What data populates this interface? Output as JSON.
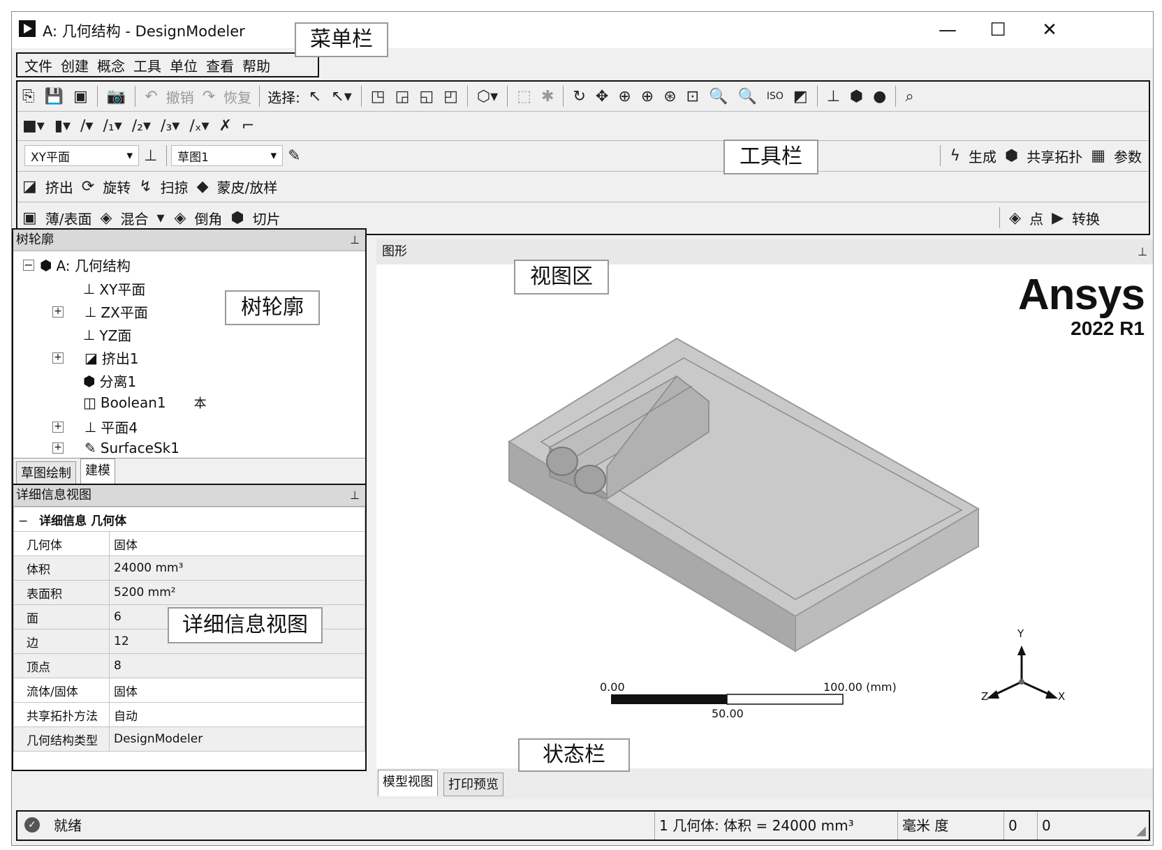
{
  "window": {
    "title": "A: 几何结构 - DesignModeler",
    "controls": {
      "minimize": "—",
      "maximize": "☐",
      "close": "✕"
    }
  },
  "menubar": {
    "items": [
      "文件",
      "创建",
      "概念",
      "工具",
      "单位",
      "查看",
      "帮助"
    ]
  },
  "toolbar": {
    "undo_label": "撤销",
    "redo_label": "恢复",
    "select_label": "选择:",
    "plane_select": "XY平面",
    "sketch_select": "草图1",
    "generate_label": "生成",
    "share_topology_label": "共享拓扑",
    "parameters_label": "参数",
    "ops_row1": [
      "挤出",
      "旋转",
      "扫掠",
      "蒙皮/放样"
    ],
    "ops_row2": [
      "薄/表面",
      "混合",
      "倒角",
      "切片"
    ],
    "point_label": "点",
    "convert_label": "转换"
  },
  "tree": {
    "header": "树轮廓",
    "items": [
      {
        "label": "A: 几何结构",
        "icon": "geometry-icon"
      },
      {
        "label": "XY平面",
        "icon": "plane-icon"
      },
      {
        "label": "ZX平面",
        "icon": "plane-icon"
      },
      {
        "label": "YZ面",
        "icon": "plane-icon"
      },
      {
        "label": "挤出1",
        "icon": "extrude-icon"
      },
      {
        "label": "分离1",
        "icon": "separate-icon"
      },
      {
        "label": "Boolean1",
        "icon": "boolean-icon",
        "suffix": "本"
      },
      {
        "label": "平面4",
        "icon": "plane-icon"
      },
      {
        "label": "SurfaceSk1",
        "icon": "surface-sketch-icon"
      }
    ],
    "tabs": [
      "草图绘制",
      "建模"
    ]
  },
  "details": {
    "header": "详细信息视图",
    "section": "详细信息 几何体",
    "rows": [
      {
        "k": "几何体",
        "v": "固体"
      },
      {
        "k": "体积",
        "v": "24000 mm³"
      },
      {
        "k": "表面积",
        "v": "5200 mm²"
      },
      {
        "k": "面",
        "v": "6"
      },
      {
        "k": "边",
        "v": "12"
      },
      {
        "k": "顶点",
        "v": "8"
      },
      {
        "k": "流体/固体",
        "v": "固体"
      },
      {
        "k": "共享拓扑方法",
        "v": "自动"
      },
      {
        "k": "几何结构类型",
        "v": "DesignModeler"
      }
    ]
  },
  "graphics": {
    "header": "图形",
    "brand": "Ansys",
    "version": "2022 R1",
    "scale": {
      "left": "0.00",
      "mid": "50.00",
      "right": "100.00 (mm)"
    },
    "axes": {
      "x": "X",
      "y": "Y",
      "z": "Z"
    },
    "tabs": [
      "模型视图",
      "打印预览"
    ]
  },
  "status": {
    "ready": "就绪",
    "info": "1 几何体: 体积 = 24000 mm³",
    "units": "毫米  度",
    "val1": "0",
    "val2": "0"
  },
  "annotations": {
    "menubar": "菜单栏",
    "toolbar": "工具栏",
    "tree": "树轮廓",
    "view": "视图区",
    "details": "详细信息视图",
    "status": "状态栏"
  }
}
